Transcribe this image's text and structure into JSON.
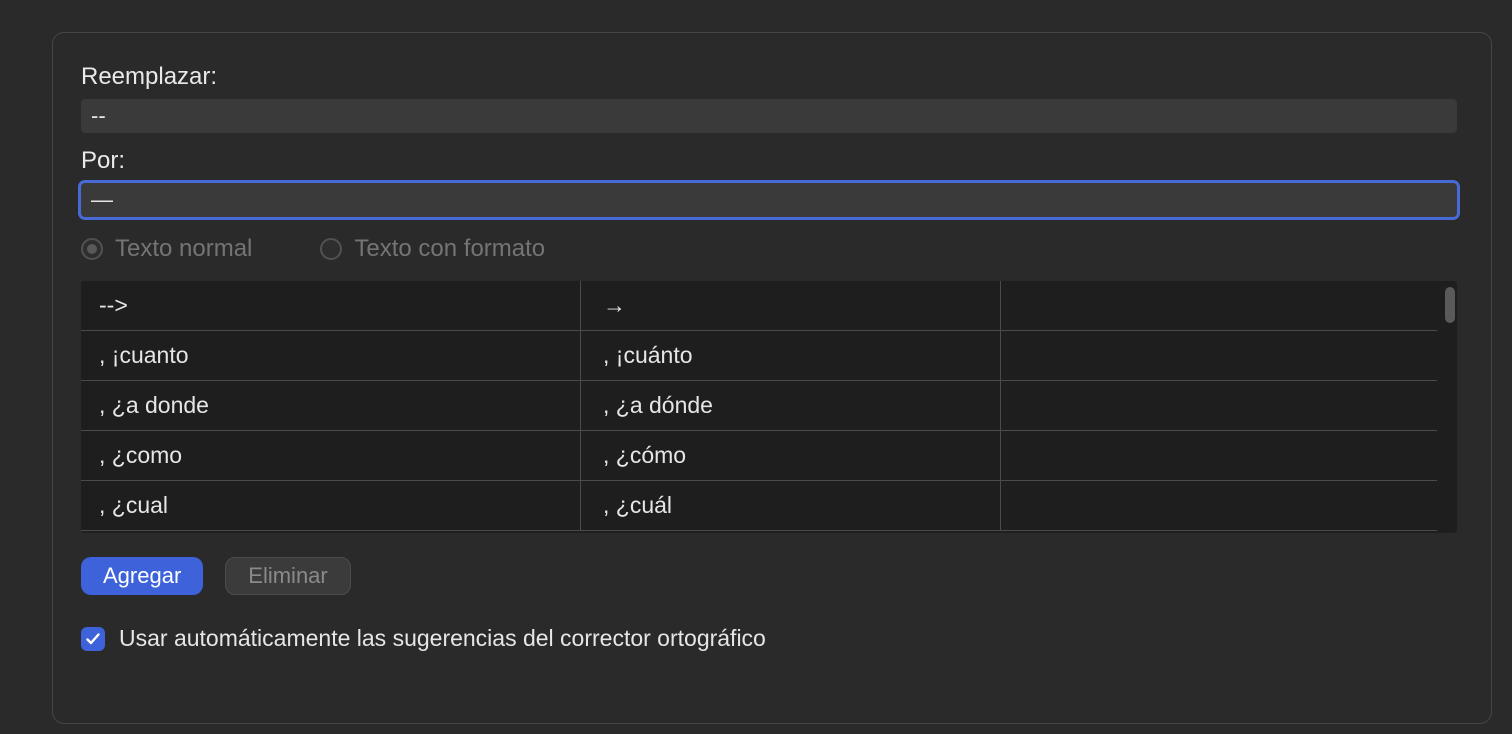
{
  "fields": {
    "replace_label": "Reemplazar:",
    "replace_value": "--",
    "with_label": "Por:",
    "with_value": "—"
  },
  "radios": {
    "plain_label": "Texto normal",
    "formatted_label": "Texto con formato",
    "plain_checked": true
  },
  "table_rows": [
    {
      "left": "-->",
      "right": "→"
    },
    {
      "left": ", ¡cuanto",
      "right": ", ¡cuánto"
    },
    {
      "left": ", ¿a donde",
      "right": ", ¿a dónde"
    },
    {
      "left": ", ¿como",
      "right": ", ¿cómo"
    },
    {
      "left": ", ¿cual",
      "right": ", ¿cuál"
    }
  ],
  "buttons": {
    "add": "Agregar",
    "delete": "Eliminar"
  },
  "checkbox": {
    "label": "Usar automáticamente las sugerencias del corrector ortográfico",
    "checked": true
  }
}
